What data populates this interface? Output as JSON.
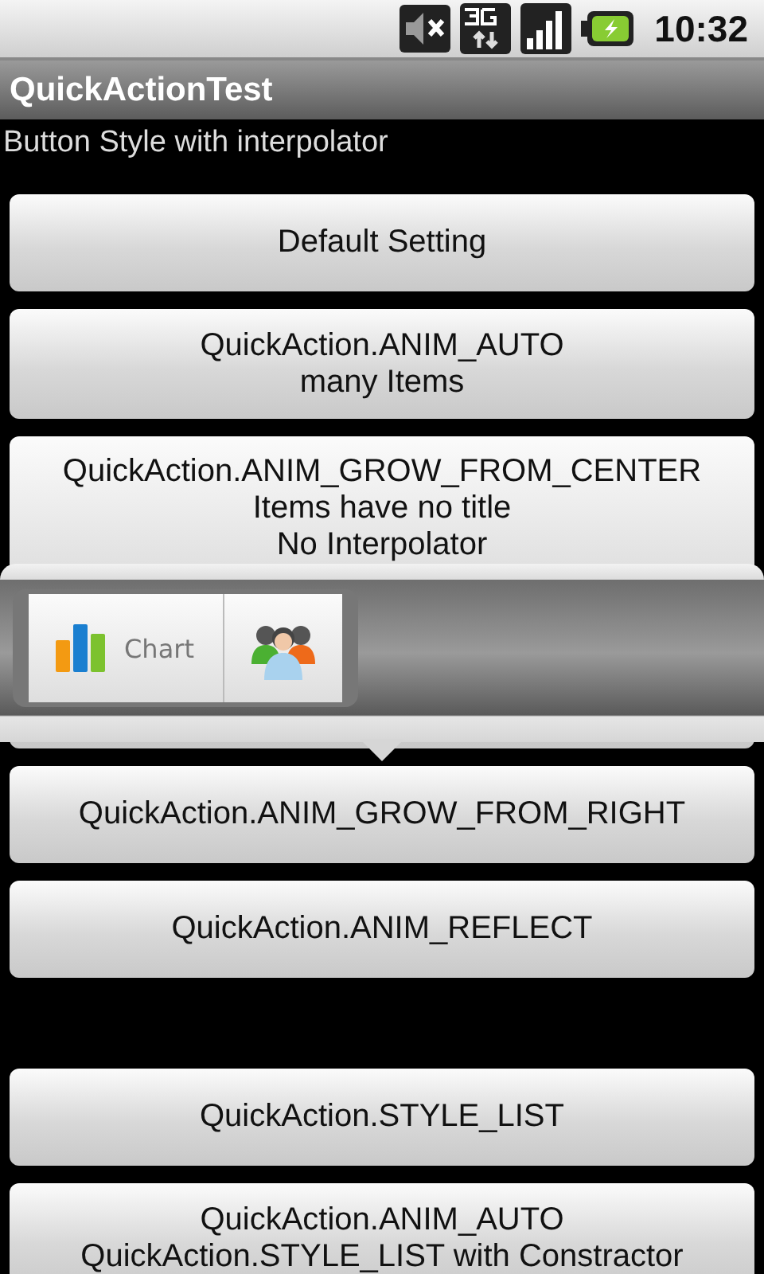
{
  "status_bar": {
    "time": "10:32"
  },
  "title_bar": {
    "title": "QuickActionTest"
  },
  "subtitle": "Button Style with interpolator",
  "buttons": [
    {
      "lines": [
        "Default Setting"
      ]
    },
    {
      "lines": [
        "QuickAction.ANIM_AUTO",
        "many Items"
      ]
    },
    {
      "lines": [
        "QuickAction.ANIM_GROW_FROM_CENTER",
        "Items have no title",
        "No Interpolator"
      ]
    },
    {
      "lines": [
        "QuickAction.ANIM_GROW_FROM_RIGHT"
      ]
    },
    {
      "lines": [
        "QuickAction.ANIM_REFLECT"
      ]
    },
    {
      "lines": [
        "QuickAction.STYLE_LIST"
      ]
    },
    {
      "lines": [
        "QuickAction.ANIM_AUTO",
        "QuickAction.STYLE_LIST with Constractor"
      ]
    }
  ],
  "popup": {
    "items": [
      {
        "kind": "chart",
        "label": "Chart"
      },
      {
        "kind": "people"
      }
    ]
  }
}
